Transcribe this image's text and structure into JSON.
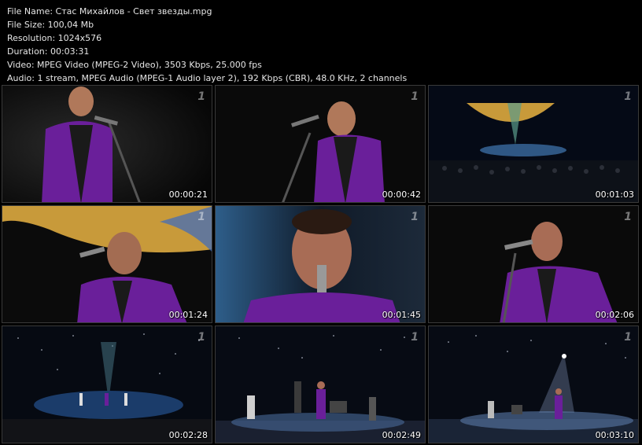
{
  "info": {
    "file_name": "File Name: Стас Михайлов - Свет звезды.mpg",
    "file_size": "File Size: 100,04 Mb",
    "resolution": "Resolution: 1024x576",
    "duration": "Duration: 00:03:31",
    "video": "Video: MPEG Video (MPEG-2 Video), 3503 Kbps, 25.000 fps",
    "audio": "Audio: 1 stream, MPEG Audio (MPEG-1 Audio layer 2), 192 Kbps (CBR), 48.0 KHz, 2 channels"
  },
  "logo_glyph": "1",
  "colors": {
    "jacket": "#6a1f9a",
    "stage_blue": "#1b3c6a",
    "background": "#000000"
  },
  "thumbnails": [
    {
      "timestamp": "00:00:21",
      "scene": "singer-closeup-left"
    },
    {
      "timestamp": "00:00:42",
      "scene": "singer-closeup-right"
    },
    {
      "timestamp": "00:01:03",
      "scene": "stage-wide-globe"
    },
    {
      "timestamp": "00:01:24",
      "scene": "singer-closeup-globe"
    },
    {
      "timestamp": "00:01:45",
      "scene": "singer-face-closeup"
    },
    {
      "timestamp": "00:02:06",
      "scene": "singer-closeup-right-mic"
    },
    {
      "timestamp": "00:02:28",
      "scene": "stage-wide-stars"
    },
    {
      "timestamp": "00:02:49",
      "scene": "band-stage"
    },
    {
      "timestamp": "00:03:10",
      "scene": "stage-spotlight"
    }
  ]
}
